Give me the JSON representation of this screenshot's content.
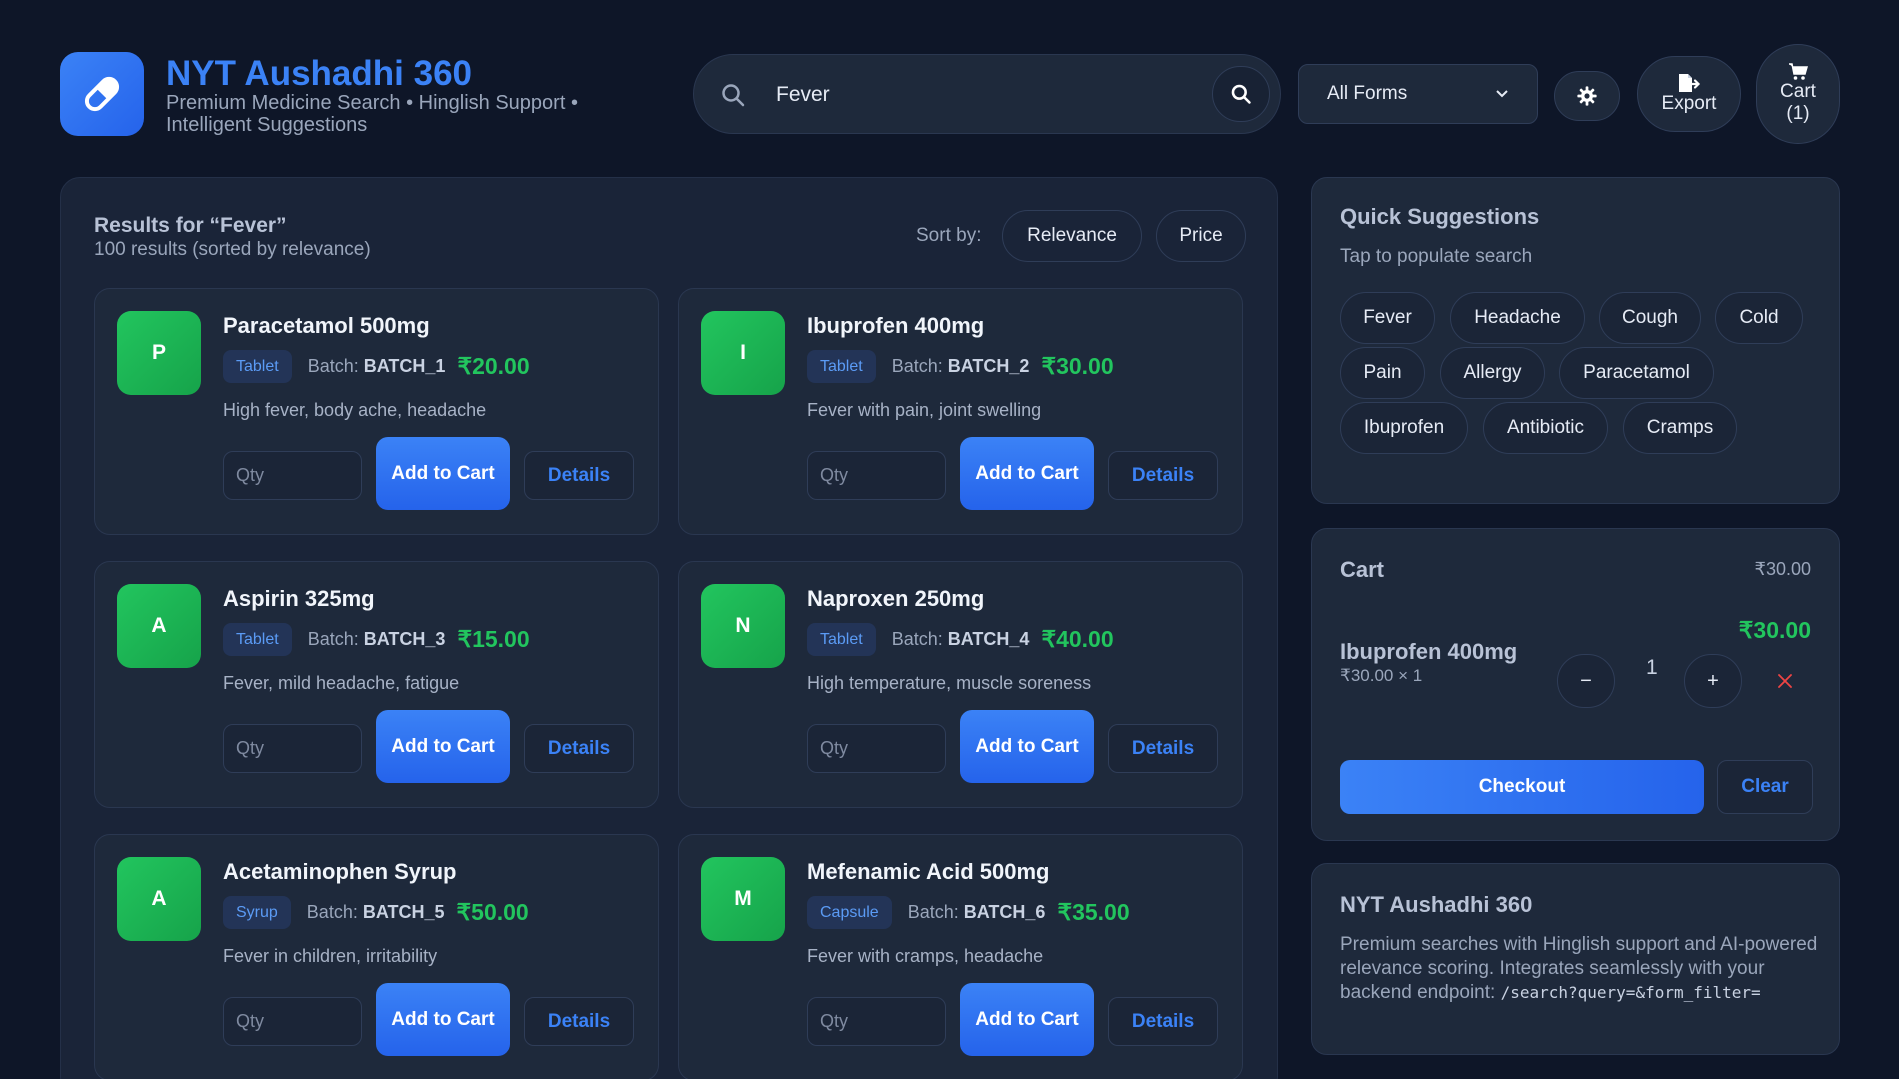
{
  "brand": {
    "title": "NYT Aushadhi 360",
    "subtitle": "Premium Medicine Search • Hinglish Support • Intelligent Suggestions"
  },
  "search": {
    "value": "Fever",
    "placeholder": "Search medicines..."
  },
  "form_filter": {
    "selected": "All Forms"
  },
  "toolbar": {
    "export_label": "Export",
    "cart_label": "Cart",
    "cart_count": "(1)"
  },
  "results": {
    "title": "Results for “Fever”",
    "count_text": "100 results (sorted by relevance)",
    "sort_label": "Sort by:",
    "sort_options": [
      "Relevance",
      "Price"
    ],
    "cards": [
      {
        "initial": "P",
        "name": "Paracetamol 500mg",
        "form": "Tablet",
        "batch_label": "Batch:",
        "batch": "BATCH_1",
        "price": "₹20.00",
        "description": "High fever, body ache, headache",
        "qty_placeholder": "Qty",
        "add_label": "Add to Cart",
        "details_label": "Details"
      },
      {
        "initial": "I",
        "name": "Ibuprofen 400mg",
        "form": "Tablet",
        "batch_label": "Batch:",
        "batch": "BATCH_2",
        "price": "₹30.00",
        "description": "Fever with pain, joint swelling",
        "qty_placeholder": "Qty",
        "add_label": "Add to Cart",
        "details_label": "Details"
      },
      {
        "initial": "A",
        "name": "Aspirin 325mg",
        "form": "Tablet",
        "batch_label": "Batch:",
        "batch": "BATCH_3",
        "price": "₹15.00",
        "description": "Fever, mild headache, fatigue",
        "qty_placeholder": "Qty",
        "add_label": "Add to Cart",
        "details_label": "Details"
      },
      {
        "initial": "N",
        "name": "Naproxen 250mg",
        "form": "Tablet",
        "batch_label": "Batch:",
        "batch": "BATCH_4",
        "price": "₹40.00",
        "description": "High temperature, muscle soreness",
        "qty_placeholder": "Qty",
        "add_label": "Add to Cart",
        "details_label": "Details"
      },
      {
        "initial": "A",
        "name": "Acetaminophen Syrup",
        "form": "Syrup",
        "batch_label": "Batch:",
        "batch": "BATCH_5",
        "price": "₹50.00",
        "description": "Fever in children, irritability",
        "qty_placeholder": "Qty",
        "add_label": "Add to Cart",
        "details_label": "Details"
      },
      {
        "initial": "M",
        "name": "Mefenamic Acid 500mg",
        "form": "Capsule",
        "batch_label": "Batch:",
        "batch": "BATCH_6",
        "price": "₹35.00",
        "description": "Fever with cramps, headache",
        "qty_placeholder": "Qty",
        "add_label": "Add to Cart",
        "details_label": "Details"
      }
    ]
  },
  "suggestions": {
    "title": "Quick Suggestions",
    "subtitle": "Tap to populate search",
    "chips": [
      "Fever",
      "Headache",
      "Cough",
      "Cold",
      "Pain",
      "Allergy",
      "Paracetamol",
      "Ibuprofen",
      "Antibiotic",
      "Cramps"
    ]
  },
  "cart": {
    "title": "Cart",
    "total": "₹30.00",
    "items": [
      {
        "name": "Ibuprofen 400mg",
        "unit_line": "₹30.00 × 1",
        "line_total": "₹30.00",
        "qty": "1",
        "minus": "−",
        "plus": "+"
      }
    ],
    "checkout_label": "Checkout",
    "clear_label": "Clear"
  },
  "about": {
    "title": "NYT Aushadhi 360",
    "text": "Premium searches with Hinglish support and AI-powered relevance scoring. Integrates seamlessly with your backend endpoint: ",
    "endpoint": "/search?query=&form_filter="
  },
  "icons": {
    "logo": "pill-icon",
    "search": "search-icon",
    "select": "chevron-down-icon",
    "theme": "gear-icon",
    "export": "file-export-icon",
    "cart": "cart-icon",
    "remove": "close-icon"
  },
  "colors": {
    "accent": "#3b82f6",
    "price": "#22c55e",
    "avatar": "#22c55e",
    "background": "#0e1628",
    "danger": "#ef4444"
  }
}
